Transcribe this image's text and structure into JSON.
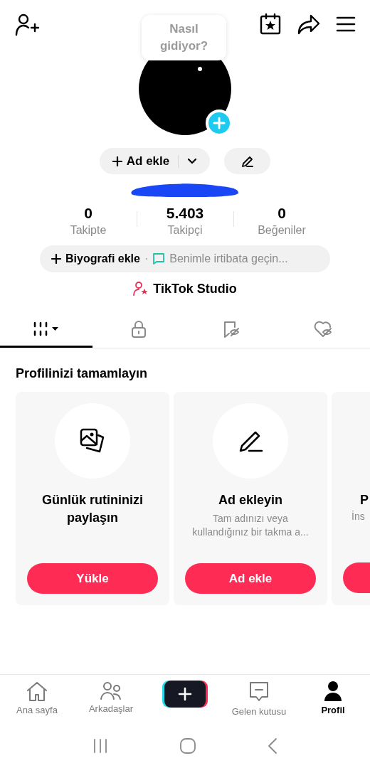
{
  "tooltip": {
    "text": "Nasıl gidiyor?"
  },
  "name_button": {
    "label": "Ad ekle"
  },
  "stats": [
    {
      "value": "0",
      "label": "Takipte"
    },
    {
      "value": "5.403",
      "label": "Takipçi"
    },
    {
      "value": "0",
      "label": "Beğeniler"
    }
  ],
  "bio_bar": {
    "add_label": "Biyografi ekle",
    "separator": "·",
    "contact": "Benimle irtibata geçin..."
  },
  "studio_link": {
    "label": "TikTok Studio"
  },
  "content_tabs": [
    {
      "kind": "videos",
      "selected": true
    },
    {
      "kind": "private",
      "selected": false
    },
    {
      "kind": "saved",
      "selected": false
    },
    {
      "kind": "liked",
      "selected": false
    }
  ],
  "section_title": "Profilinizi tamamlayın",
  "cards": [
    {
      "kind": "photos",
      "title": "Günlük rutininizi paylaşın",
      "button": "Yükle"
    },
    {
      "kind": "name",
      "title": "Ad ekleyin",
      "description": "Tam adınızı veya kullandığınız bir takma a...",
      "button": "Ad ekle"
    },
    {
      "kind": "partial",
      "title": "P",
      "description": "İns"
    }
  ],
  "bottom_nav": [
    {
      "kind": "home",
      "label": "Ana sayfa",
      "selected": false
    },
    {
      "kind": "friends",
      "label": "Arkadaşlar",
      "selected": false
    },
    {
      "kind": "create",
      "selected": false
    },
    {
      "kind": "inbox",
      "label": "Gelen kutusu",
      "selected": false
    },
    {
      "kind": "profile",
      "label": "Profil",
      "selected": true
    }
  ]
}
